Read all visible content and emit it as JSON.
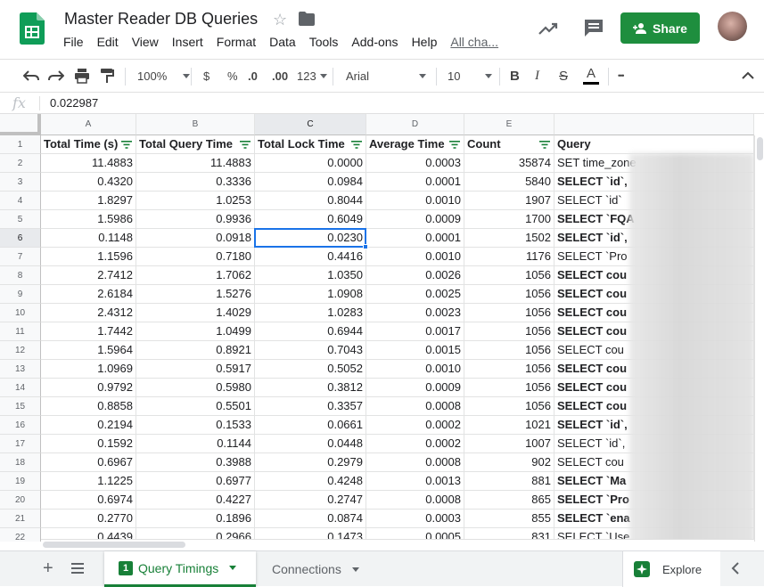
{
  "header": {
    "title": "Master Reader DB Queries",
    "menu": [
      "File",
      "Edit",
      "View",
      "Insert",
      "Format",
      "Data",
      "Tools",
      "Add-ons",
      "Help"
    ],
    "last_edit": "All cha...",
    "share_label": "Share"
  },
  "toolbar": {
    "zoom": "100%",
    "currency": "$",
    "percent": "%",
    "decrease_decimals": ".0",
    "increase_decimals": ".00",
    "more_formats": "123",
    "font": "Arial",
    "font_size": "10",
    "bold": "B",
    "italic": "I",
    "strike": "S",
    "text_color": "A",
    "more": "•••"
  },
  "formula_bar": {
    "fx": "fx",
    "value": "0.022987"
  },
  "columns": [
    "A",
    "B",
    "C",
    "D",
    "E"
  ],
  "selected_column": "C",
  "selected_row": 6,
  "headers": [
    "Total Time (s)",
    "Total Query Time",
    "Total Lock Time",
    "Average Time",
    "Count",
    "Query"
  ],
  "rows": [
    [
      "11.4883",
      "11.4883",
      "0.0000",
      "0.0003",
      "35874",
      "SET time_zone"
    ],
    [
      "0.4320",
      "0.3336",
      "0.0984",
      "0.0001",
      "5840",
      "SELECT `id`,"
    ],
    [
      "1.8297",
      "1.0253",
      "0.8044",
      "0.0010",
      "1907",
      "SELECT `id`"
    ],
    [
      "1.5986",
      "0.9936",
      "0.6049",
      "0.0009",
      "1700",
      "SELECT `FQA"
    ],
    [
      "0.1148",
      "0.0918",
      "0.0230",
      "0.0001",
      "1502",
      "SELECT `id`,"
    ],
    [
      "1.1596",
      "0.7180",
      "0.4416",
      "0.0010",
      "1176",
      "SELECT `Pro"
    ],
    [
      "2.7412",
      "1.7062",
      "1.0350",
      "0.0026",
      "1056",
      "SELECT cou"
    ],
    [
      "2.6184",
      "1.5276",
      "1.0908",
      "0.0025",
      "1056",
      "SELECT cou"
    ],
    [
      "2.4312",
      "1.4029",
      "1.0283",
      "0.0023",
      "1056",
      "SELECT cou"
    ],
    [
      "1.7442",
      "1.0499",
      "0.6944",
      "0.0017",
      "1056",
      "SELECT cou"
    ],
    [
      "1.5964",
      "0.8921",
      "0.7043",
      "0.0015",
      "1056",
      "SELECT cou"
    ],
    [
      "1.0969",
      "0.5917",
      "0.5052",
      "0.0010",
      "1056",
      "SELECT cou"
    ],
    [
      "0.9792",
      "0.5980",
      "0.3812",
      "0.0009",
      "1056",
      "SELECT cou"
    ],
    [
      "0.8858",
      "0.5501",
      "0.3357",
      "0.0008",
      "1056",
      "SELECT cou"
    ],
    [
      "0.2194",
      "0.1533",
      "0.0661",
      "0.0002",
      "1021",
      "SELECT `id`,"
    ],
    [
      "0.1592",
      "0.1144",
      "0.0448",
      "0.0002",
      "1007",
      "SELECT `id`,"
    ],
    [
      "0.6967",
      "0.3988",
      "0.2979",
      "0.0008",
      "902",
      "SELECT cou"
    ],
    [
      "1.1225",
      "0.6977",
      "0.4248",
      "0.0013",
      "881",
      "SELECT `Ma"
    ],
    [
      "0.6974",
      "0.4227",
      "0.2747",
      "0.0008",
      "865",
      "SELECT `Pro"
    ],
    [
      "0.2770",
      "0.1896",
      "0.0874",
      "0.0003",
      "855",
      "SELECT `ena"
    ],
    [
      "0.4439",
      "0.2966",
      "0.1473",
      "0.0005",
      "831",
      "SELECT `Use"
    ]
  ],
  "bold_query_rows": [
    3,
    5,
    6,
    8,
    9,
    10,
    11,
    13,
    14,
    15,
    16,
    19,
    20,
    21
  ],
  "sheets": {
    "active": {
      "index": "1",
      "label": "Query Timings"
    },
    "others": [
      "Connections"
    ],
    "explore_label": "Explore"
  },
  "colors": {
    "accent_green": "#188038",
    "selection_blue": "#1a73e8"
  }
}
